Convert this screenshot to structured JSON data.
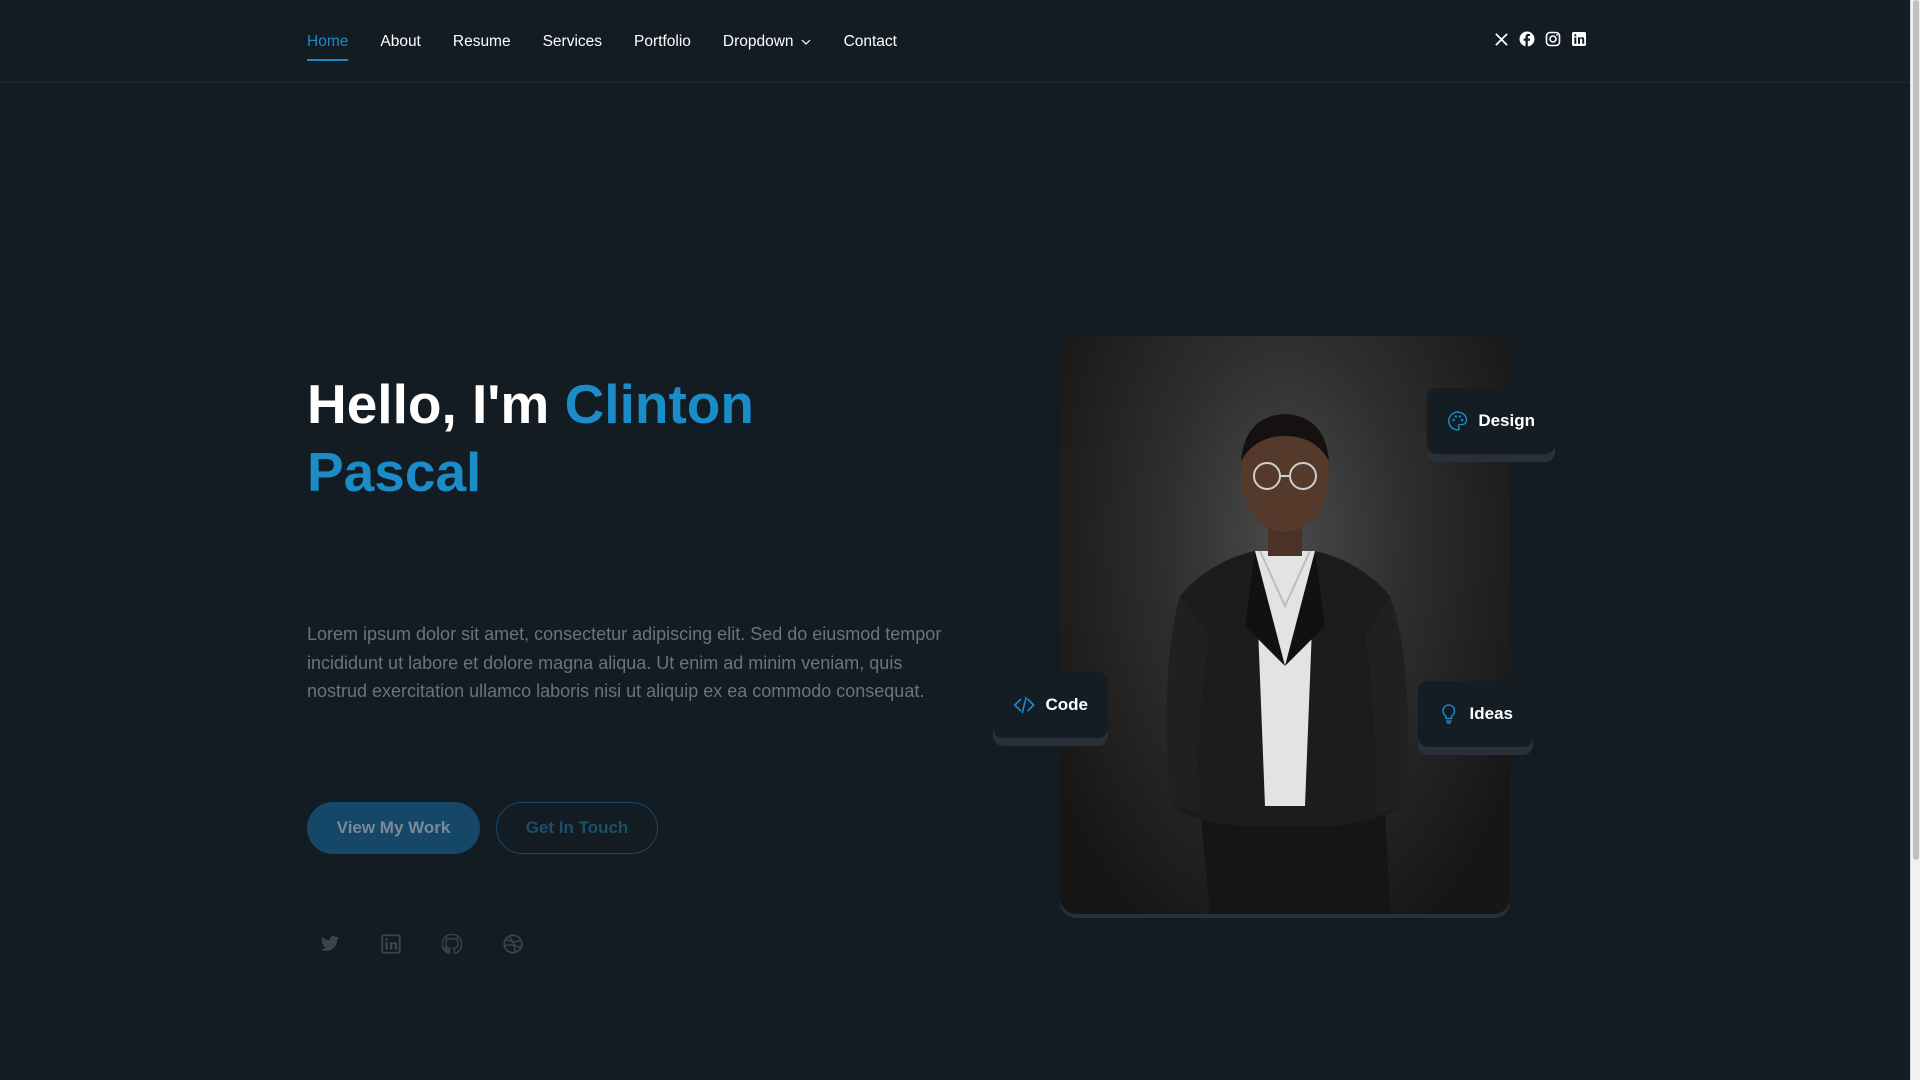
{
  "nav": {
    "items": [
      {
        "label": "Home",
        "active": true
      },
      {
        "label": "About"
      },
      {
        "label": "Resume"
      },
      {
        "label": "Services"
      },
      {
        "label": "Portfolio"
      },
      {
        "label": "Dropdown",
        "has_dropdown": true
      },
      {
        "label": "Contact"
      }
    ]
  },
  "header_social": [
    "x-icon",
    "facebook-icon",
    "instagram-icon",
    "linkedin-icon"
  ],
  "hero": {
    "greeting": "Hello, I'm ",
    "name": "Clinton Pascal",
    "description": "Lorem ipsum dolor sit amet, consectetur adipiscing elit. Sed do eiusmod tempor incididunt ut labore et dolore magna aliqua. Ut enim ad minim veniam, quis nostrud exercitation ullamco laboris nisi ut aliquip ex ea commodo consequat.",
    "primary_button": "View My Work",
    "secondary_button": "Get In Touch",
    "social": [
      "twitter-icon",
      "linkedin-icon",
      "github-icon",
      "dribbble-icon"
    ]
  },
  "badges": {
    "design": "Design",
    "code": "Code",
    "ideas": "Ideas"
  },
  "colors": {
    "background": "#131b23",
    "accent": "#1b8cc7",
    "muted_text": "#6b737b"
  }
}
